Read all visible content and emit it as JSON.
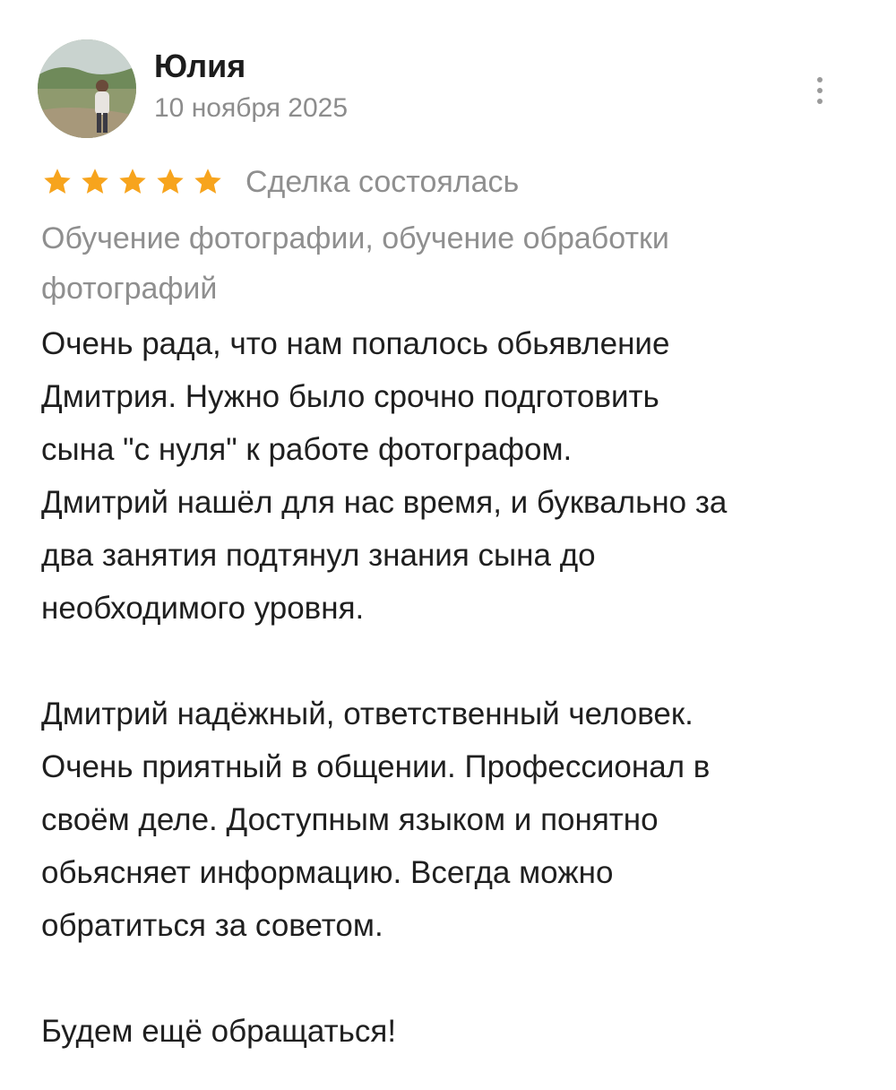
{
  "review": {
    "author": "Юлия",
    "date": "10 ноября 2025",
    "rating": 5,
    "rating_max": 5,
    "deal_status": "Сделка состоялась",
    "category_line1": "Обучение фотографии, обучение обработки",
    "category_line2": "фотографий",
    "paragraphs": [
      [
        "Очень рада, что нам попалось обьявление",
        "Дмитрия. Нужно было срочно подготовить",
        "сына \"с нуля\" к работе фотографом.",
        "Дмитрий нашёл для нас время, и буквально за",
        "два занятия подтянул знания сына до",
        "необходимого уровня."
      ],
      [
        "Дмитрий надёжный, ответственный человек.",
        "Очень приятный в общении. Профессионал в",
        "своём деле. Доступным языком и понятно",
        "обьясняет информацию. Всегда можно",
        "обратиться за советом."
      ],
      [
        "Будем ещё обращаться!"
      ]
    ]
  },
  "colors": {
    "star": "#f7a41d",
    "muted_text": "#8f8f8f",
    "main_text": "#1f1f1f"
  },
  "icons": {
    "more": "more-vertical-icon",
    "star": "star-icon"
  }
}
